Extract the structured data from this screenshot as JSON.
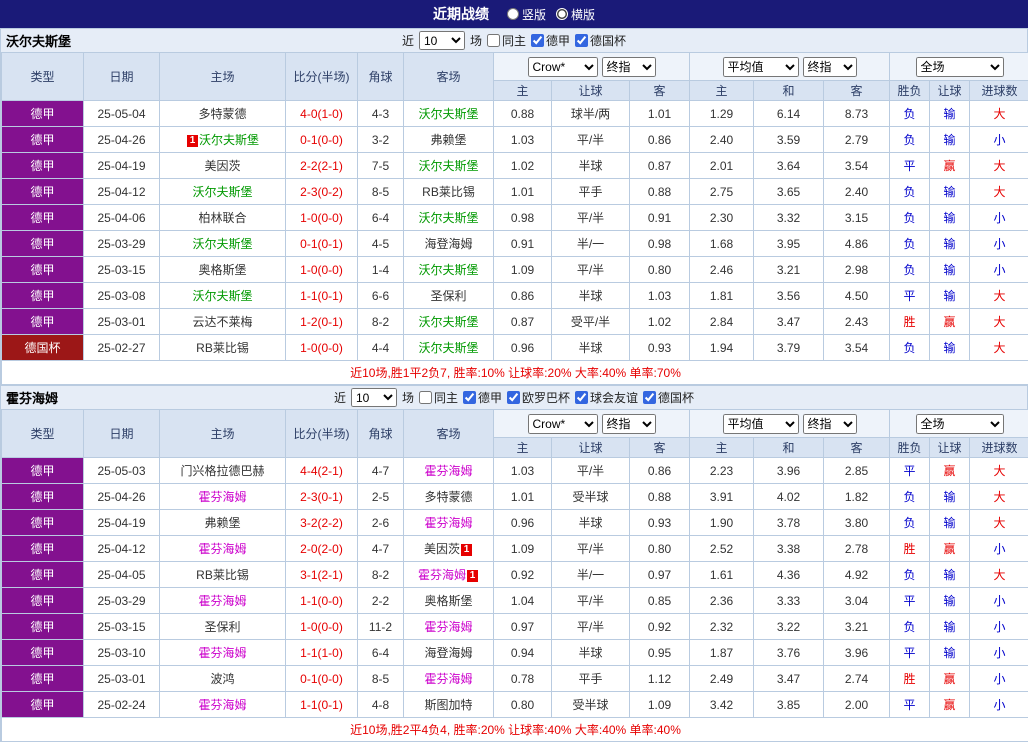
{
  "top_bar": {
    "title": "近期战绩",
    "radios": [
      {
        "label": "竖版",
        "selected": false
      },
      {
        "label": "横版",
        "selected": true
      }
    ]
  },
  "table_header": {
    "main_cols": [
      "类型",
      "日期",
      "主场",
      "比分(半场)",
      "角球",
      "客场"
    ],
    "sub_cols": [
      "主",
      "让球",
      "客",
      "主",
      "和",
      "客",
      "胜负",
      "让球",
      "进球数"
    ],
    "group1_selects": [
      "Crow*",
      "终指"
    ],
    "group2_selects": [
      "平均值",
      "终指"
    ],
    "group3_selects": [
      "全场"
    ]
  },
  "colors": {
    "topbar_bg": "#1a1a78",
    "league_purple": "#83118f",
    "cup_red": "#9c1717",
    "score_red": "#e60000",
    "result_red": "#e60000",
    "result_blue": "#0000cc",
    "wolfsburg_highlight": "#009900",
    "hoffenheim_highlight": "#cc00cc"
  },
  "sections": [
    {
      "team": "沃尔夫斯堡",
      "hl_color": "#009900",
      "filter": {
        "prefix": "近",
        "count": "10",
        "suffix": "场",
        "checkboxes": [
          {
            "label": "同主",
            "checked": false
          },
          {
            "label": "德甲",
            "checked": true
          },
          {
            "label": "德国杯",
            "checked": true
          }
        ]
      },
      "rows": [
        {
          "league": "德甲",
          "cup": false,
          "date": "25-05-04",
          "home": "多特蒙德",
          "home_hl": false,
          "home_badge": "",
          "home_badge_pos": "",
          "score": "4-0(1-0)",
          "corner": "4-3",
          "away": "沃尔夫斯堡",
          "away_hl": true,
          "away_badge": "",
          "odds": [
            "0.88",
            "球半/两",
            "1.01"
          ],
          "avg": [
            "1.29",
            "6.14",
            "8.73"
          ],
          "result": [
            "负",
            "输",
            "大"
          ]
        },
        {
          "league": "德甲",
          "cup": false,
          "date": "25-04-26",
          "home": "沃尔夫斯堡",
          "home_hl": true,
          "home_badge": "1",
          "home_badge_pos": "left",
          "score": "0-1(0-0)",
          "corner": "3-2",
          "away": "弗赖堡",
          "away_hl": false,
          "away_badge": "",
          "odds": [
            "1.03",
            "平/半",
            "0.86"
          ],
          "avg": [
            "2.40",
            "3.59",
            "2.79"
          ],
          "result": [
            "负",
            "输",
            "小"
          ]
        },
        {
          "league": "德甲",
          "cup": false,
          "date": "25-04-19",
          "home": "美因茨",
          "home_hl": false,
          "home_badge": "",
          "score": "2-2(2-1)",
          "corner": "7-5",
          "away": "沃尔夫斯堡",
          "away_hl": true,
          "away_badge": "",
          "odds": [
            "1.02",
            "半球",
            "0.87"
          ],
          "avg": [
            "2.01",
            "3.64",
            "3.54"
          ],
          "result": [
            "平",
            "赢",
            "大"
          ]
        },
        {
          "league": "德甲",
          "cup": false,
          "date": "25-04-12",
          "home": "沃尔夫斯堡",
          "home_hl": true,
          "home_badge": "",
          "score": "2-3(0-2)",
          "corner": "8-5",
          "away": "RB莱比锡",
          "away_hl": false,
          "away_badge": "",
          "odds": [
            "1.01",
            "平手",
            "0.88"
          ],
          "avg": [
            "2.75",
            "3.65",
            "2.40"
          ],
          "result": [
            "负",
            "输",
            "大"
          ]
        },
        {
          "league": "德甲",
          "cup": false,
          "date": "25-04-06",
          "home": "柏林联合",
          "home_hl": false,
          "home_badge": "",
          "score": "1-0(0-0)",
          "corner": "6-4",
          "away": "沃尔夫斯堡",
          "away_hl": true,
          "away_badge": "",
          "odds": [
            "0.98",
            "平/半",
            "0.91"
          ],
          "avg": [
            "2.30",
            "3.32",
            "3.15"
          ],
          "result": [
            "负",
            "输",
            "小"
          ]
        },
        {
          "league": "德甲",
          "cup": false,
          "date": "25-03-29",
          "home": "沃尔夫斯堡",
          "home_hl": true,
          "home_badge": "",
          "score": "0-1(0-1)",
          "corner": "4-5",
          "away": "海登海姆",
          "away_hl": false,
          "away_badge": "",
          "odds": [
            "0.91",
            "半/一",
            "0.98"
          ],
          "avg": [
            "1.68",
            "3.95",
            "4.86"
          ],
          "result": [
            "负",
            "输",
            "小"
          ]
        },
        {
          "league": "德甲",
          "cup": false,
          "date": "25-03-15",
          "home": "奥格斯堡",
          "home_hl": false,
          "home_badge": "",
          "score": "1-0(0-0)",
          "corner": "1-4",
          "away": "沃尔夫斯堡",
          "away_hl": true,
          "away_badge": "",
          "odds": [
            "1.09",
            "平/半",
            "0.80"
          ],
          "avg": [
            "2.46",
            "3.21",
            "2.98"
          ],
          "result": [
            "负",
            "输",
            "小"
          ]
        },
        {
          "league": "德甲",
          "cup": false,
          "date": "25-03-08",
          "home": "沃尔夫斯堡",
          "home_hl": true,
          "home_badge": "",
          "score": "1-1(0-1)",
          "corner": "6-6",
          "away": "圣保利",
          "away_hl": false,
          "away_badge": "",
          "odds": [
            "0.86",
            "半球",
            "1.03"
          ],
          "avg": [
            "1.81",
            "3.56",
            "4.50"
          ],
          "result": [
            "平",
            "输",
            "大"
          ]
        },
        {
          "league": "德甲",
          "cup": false,
          "date": "25-03-01",
          "home": "云达不莱梅",
          "home_hl": false,
          "home_badge": "",
          "score": "1-2(0-1)",
          "corner": "8-2",
          "away": "沃尔夫斯堡",
          "away_hl": true,
          "away_badge": "",
          "odds": [
            "0.87",
            "受平/半",
            "1.02"
          ],
          "avg": [
            "2.84",
            "3.47",
            "2.43"
          ],
          "result": [
            "胜",
            "赢",
            "大"
          ]
        },
        {
          "league": "德国杯",
          "cup": true,
          "date": "25-02-27",
          "home": "RB莱比锡",
          "home_hl": false,
          "home_badge": "",
          "score": "1-0(0-0)",
          "corner": "4-4",
          "away": "沃尔夫斯堡",
          "away_hl": true,
          "away_badge": "",
          "odds": [
            "0.96",
            "半球",
            "0.93"
          ],
          "avg": [
            "1.94",
            "3.79",
            "3.54"
          ],
          "result": [
            "负",
            "输",
            "大"
          ]
        }
      ],
      "summary": "近10场,胜1平2负7, 胜率:10% 让球率:20% 大率:40% 单率:70%"
    },
    {
      "team": "霍芬海姆",
      "hl_color": "#cc00cc",
      "filter": {
        "prefix": "近",
        "count": "10",
        "suffix": "场",
        "checkboxes": [
          {
            "label": "同主",
            "checked": false
          },
          {
            "label": "德甲",
            "checked": true
          },
          {
            "label": "欧罗巴杯",
            "checked": true
          },
          {
            "label": "球会友谊",
            "checked": true
          },
          {
            "label": "德国杯",
            "checked": true
          }
        ]
      },
      "rows": [
        {
          "league": "德甲",
          "cup": false,
          "date": "25-05-03",
          "home": "门兴格拉德巴赫",
          "home_hl": false,
          "home_badge": "",
          "score": "4-4(2-1)",
          "corner": "4-7",
          "away": "霍芬海姆",
          "away_hl": true,
          "away_badge": "",
          "odds": [
            "1.03",
            "平/半",
            "0.86"
          ],
          "avg": [
            "2.23",
            "3.96",
            "2.85"
          ],
          "result": [
            "平",
            "赢",
            "大"
          ]
        },
        {
          "league": "德甲",
          "cup": false,
          "date": "25-04-26",
          "home": "霍芬海姆",
          "home_hl": true,
          "home_badge": "",
          "score": "2-3(0-1)",
          "corner": "2-5",
          "away": "多特蒙德",
          "away_hl": false,
          "away_badge": "",
          "odds": [
            "1.01",
            "受半球",
            "0.88"
          ],
          "avg": [
            "3.91",
            "4.02",
            "1.82"
          ],
          "result": [
            "负",
            "输",
            "大"
          ]
        },
        {
          "league": "德甲",
          "cup": false,
          "date": "25-04-19",
          "home": "弗赖堡",
          "home_hl": false,
          "home_badge": "",
          "score": "3-2(2-2)",
          "corner": "2-6",
          "away": "霍芬海姆",
          "away_hl": true,
          "away_badge": "",
          "odds": [
            "0.96",
            "半球",
            "0.93"
          ],
          "avg": [
            "1.90",
            "3.78",
            "3.80"
          ],
          "result": [
            "负",
            "输",
            "大"
          ]
        },
        {
          "league": "德甲",
          "cup": false,
          "date": "25-04-12",
          "home": "霍芬海姆",
          "home_hl": true,
          "home_badge": "",
          "score": "2-0(2-0)",
          "corner": "4-7",
          "away": "美因茨",
          "away_hl": false,
          "away_badge": "1",
          "away_badge_pos": "right",
          "odds": [
            "1.09",
            "平/半",
            "0.80"
          ],
          "avg": [
            "2.52",
            "3.38",
            "2.78"
          ],
          "result": [
            "胜",
            "赢",
            "小"
          ]
        },
        {
          "league": "德甲",
          "cup": false,
          "date": "25-04-05",
          "home": "RB莱比锡",
          "home_hl": false,
          "home_badge": "",
          "score": "3-1(2-1)",
          "corner": "8-2",
          "away": "霍芬海姆",
          "away_hl": true,
          "away_badge": "1",
          "away_badge_pos": "right",
          "odds": [
            "0.92",
            "半/一",
            "0.97"
          ],
          "avg": [
            "1.61",
            "4.36",
            "4.92"
          ],
          "result": [
            "负",
            "输",
            "大"
          ]
        },
        {
          "league": "德甲",
          "cup": false,
          "date": "25-03-29",
          "home": "霍芬海姆",
          "home_hl": true,
          "home_badge": "",
          "score": "1-1(0-0)",
          "corner": "2-2",
          "away": "奥格斯堡",
          "away_hl": false,
          "away_badge": "",
          "odds": [
            "1.04",
            "平/半",
            "0.85"
          ],
          "avg": [
            "2.36",
            "3.33",
            "3.04"
          ],
          "result": [
            "平",
            "输",
            "小"
          ]
        },
        {
          "league": "德甲",
          "cup": false,
          "date": "25-03-15",
          "home": "圣保利",
          "home_hl": false,
          "home_badge": "",
          "score": "1-0(0-0)",
          "corner": "11-2",
          "away": "霍芬海姆",
          "away_hl": true,
          "away_badge": "",
          "odds": [
            "0.97",
            "平/半",
            "0.92"
          ],
          "avg": [
            "2.32",
            "3.22",
            "3.21"
          ],
          "result": [
            "负",
            "输",
            "小"
          ]
        },
        {
          "league": "德甲",
          "cup": false,
          "date": "25-03-10",
          "home": "霍芬海姆",
          "home_hl": true,
          "home_badge": "",
          "score": "1-1(1-0)",
          "corner": "6-4",
          "away": "海登海姆",
          "away_hl": false,
          "away_badge": "",
          "odds": [
            "0.94",
            "半球",
            "0.95"
          ],
          "avg": [
            "1.87",
            "3.76",
            "3.96"
          ],
          "result": [
            "平",
            "输",
            "小"
          ]
        },
        {
          "league": "德甲",
          "cup": false,
          "date": "25-03-01",
          "home": "波鸿",
          "home_hl": false,
          "home_badge": "",
          "score": "0-1(0-0)",
          "corner": "8-5",
          "away": "霍芬海姆",
          "away_hl": true,
          "away_badge": "",
          "odds": [
            "0.78",
            "平手",
            "1.12"
          ],
          "avg": [
            "2.49",
            "3.47",
            "2.74"
          ],
          "result": [
            "胜",
            "赢",
            "小"
          ]
        },
        {
          "league": "德甲",
          "cup": false,
          "date": "25-02-24",
          "home": "霍芬海姆",
          "home_hl": true,
          "home_badge": "",
          "score": "1-1(0-1)",
          "corner": "4-8",
          "away": "斯图加特",
          "away_hl": false,
          "away_badge": "",
          "odds": [
            "0.80",
            "受半球",
            "1.09"
          ],
          "avg": [
            "3.42",
            "3.85",
            "2.00"
          ],
          "result": [
            "平",
            "赢",
            "小"
          ]
        }
      ],
      "summary": "近10场,胜2平4负4, 胜率:20% 让球率:40% 大率:40% 单率:40%"
    }
  ]
}
